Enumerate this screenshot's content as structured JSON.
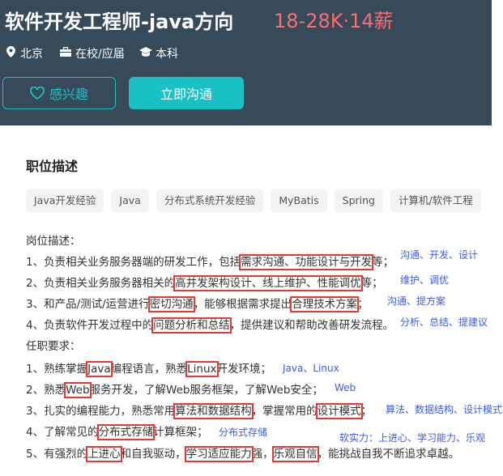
{
  "header": {
    "title": "软件开发工程师-java方向",
    "salary": "18-28K·14薪",
    "location": "北京",
    "status": "在校/应届",
    "degree": "本科",
    "interest_label": "感兴趣",
    "chat_label": "立即沟通"
  },
  "section": {
    "title": "职位描述"
  },
  "tags": [
    "Java开发经验",
    "Java",
    "分布式系统开发经验",
    "MyBatis",
    "Spring",
    "计算机/软件工程"
  ],
  "desc": {
    "heading": "岗位描述：",
    "l1a": "1、负责相关业务服务器端的研发工作，包括",
    "l1h": "需求沟通、功能设计与开发",
    "l1b": "等；",
    "l2a": "2、负责相关业务服务器相关的",
    "l2h": "高并发架构设计、线上维护、性能调优",
    "l2b": "等；",
    "l3a": "3、和产品/测试/运营进行",
    "l3h1": "密切沟通",
    "l3b": "，能够根据需求提出",
    "l3h2": "合理技术方案",
    "l3c": "；",
    "l4a": "4、负责软件开发过程中的",
    "l4h": "问题分析和总结",
    "l4b": "，提供建议和帮助改善研发流程。"
  },
  "req": {
    "heading": "任职要求：",
    "r1a": "1、熟练掌握",
    "r1h1": "Java",
    "r1b": "编程语言，熟悉",
    "r1h2": "Linux",
    "r1c": "开发环境；",
    "r2a": "2、熟悉",
    "r2h": "Web",
    "r2b": "服务开发，了解Web服务框架，了解Web安全；",
    "r3a": "3、扎实的编程能力，熟悉常用",
    "r3h1": "算法和数据结构",
    "r3b": "，掌握常用的",
    "r3h2": "设计模式",
    "r3c": "；",
    "r4a": "4、了解常见的",
    "r4h": "分布式存储",
    "r4b": "计算框架；",
    "r5a": "5、有强烈的",
    "r5h1": "上进心",
    "r5b": "和自我驱动，",
    "r5h2": "学习适应能力",
    "r5c": "强，",
    "r5h3": "乐观自信",
    "r5d": "，能挑战自我不断追求卓越。"
  },
  "notes": {
    "n1": "沟通、开发、设计",
    "n2": "维护、调优",
    "n3": "沟通、提方案",
    "n4": "分析、总结、提建议",
    "n5": "Java、Linux",
    "n6": "Web",
    "n7": "算法、数据结构、设计模式",
    "n8": "分布式存储",
    "n9": "软实力：上进心、学习能力、乐观"
  },
  "colors": {
    "header_bg": "#374a5a",
    "accent": "#19c1c5",
    "salary": "#ff6b72",
    "highlight_box": "#e53935",
    "note": "#3d5be6"
  },
  "icons": [
    "location-pin-icon",
    "briefcase-icon",
    "graduation-cap-icon",
    "heart-icon"
  ]
}
